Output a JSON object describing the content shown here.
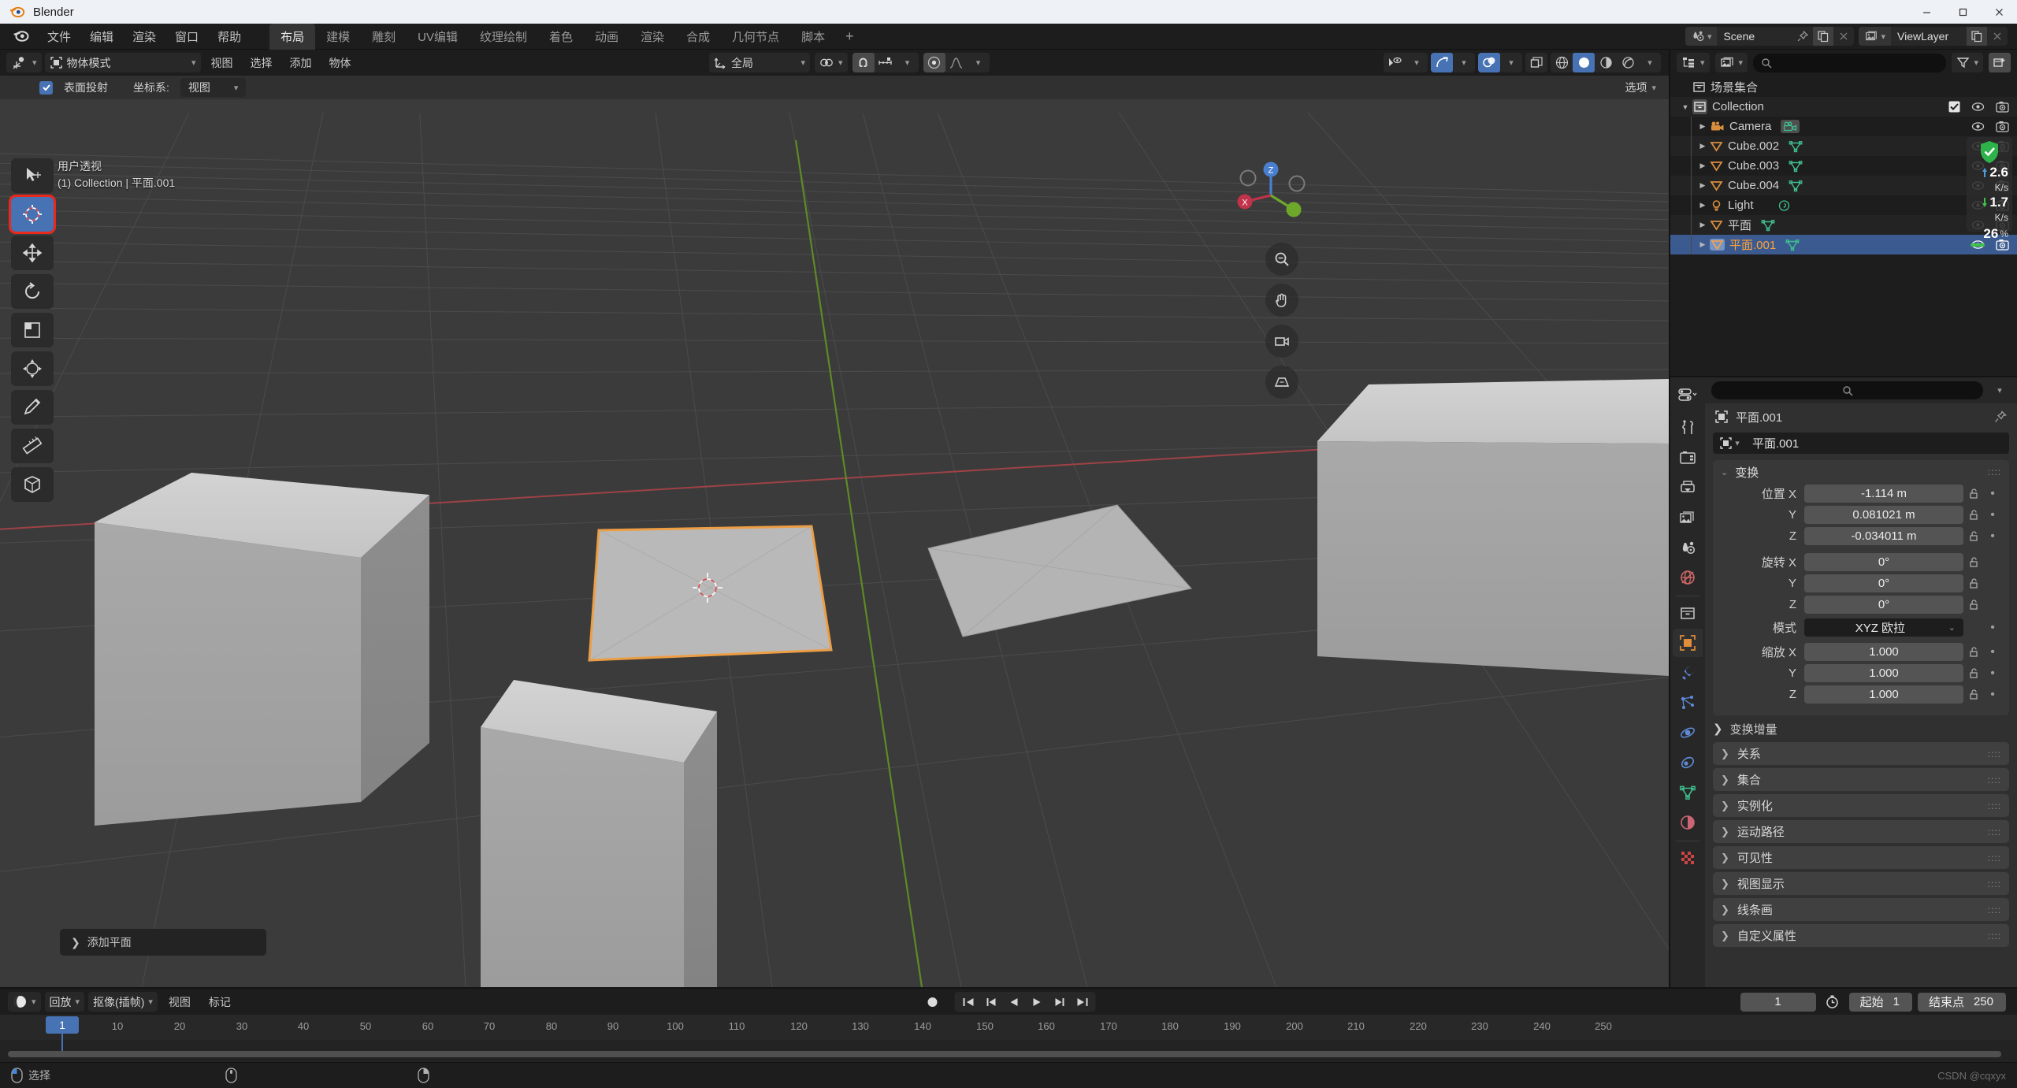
{
  "window": {
    "title": "Blender",
    "logo_icon": "blender-logo-icon",
    "minimize_icon": "minimize-icon",
    "maximize_icon": "maximize-icon",
    "close_icon": "close-icon"
  },
  "topbar": {
    "app_icon": "blender-icon",
    "menus": [
      {
        "label": "文件",
        "name": "menu-file"
      },
      {
        "label": "编辑",
        "name": "menu-edit"
      },
      {
        "label": "渲染",
        "name": "menu-render"
      },
      {
        "label": "窗口",
        "name": "menu-window"
      },
      {
        "label": "帮助",
        "name": "menu-help"
      }
    ],
    "workspaces": [
      {
        "label": "布局",
        "active": true
      },
      {
        "label": "建模",
        "active": false
      },
      {
        "label": "雕刻",
        "active": false
      },
      {
        "label": "UV编辑",
        "active": false
      },
      {
        "label": "纹理绘制",
        "active": false
      },
      {
        "label": "着色",
        "active": false
      },
      {
        "label": "动画",
        "active": false
      },
      {
        "label": "渲染",
        "active": false
      },
      {
        "label": "合成",
        "active": false
      },
      {
        "label": "几何节点",
        "active": false
      },
      {
        "label": "脚本",
        "active": false
      }
    ],
    "add_workspace_label": "+",
    "scene": {
      "name": "Scene",
      "icon": "scene-icon",
      "pin_icon": "pin-icon",
      "copy_icon": "new-scene-icon",
      "delete_icon": "unlink-icon"
    },
    "viewlayer": {
      "name": "ViewLayer",
      "icon": "viewlayer-icon",
      "copy_icon": "new-viewlayer-icon",
      "delete_icon": "remove-viewlayer-icon"
    }
  },
  "viewport": {
    "editor_type_icon": "editor-type-3dview-icon",
    "mode": "物体模式",
    "mode_icon": "object-mode-icon",
    "menus": [
      "视图",
      "选择",
      "添加",
      "物体"
    ],
    "transform_orientation": {
      "label": "全局",
      "icon": "orientation-icon"
    },
    "pivot_icon": "pivot-point-icon",
    "snap_icon": "snap-magnet-icon",
    "snap_target_icon": "snap-increment-icon",
    "proportional_icon": "proportional-edit-icon",
    "falloff_icon": "falloff-curve-icon",
    "right_controls": {
      "visibility_icon": "object-visibility-icon",
      "gizmo_icon": "gizmo-icon",
      "overlays_icon": "overlays-icon",
      "xray_icon": "xray-toggle-icon",
      "shading_modes": [
        "wireframe-shading-icon",
        "solid-shading-icon",
        "material-preview-icon",
        "rendered-shading-icon"
      ],
      "shading_active_index": 1
    },
    "subheader": {
      "checkbox_label": "表面投射",
      "checkbox_checked": true,
      "orientation_label": "坐标系:",
      "orientation_value": "视图",
      "options_label": "选项"
    },
    "overlay_text": {
      "line1": "用户透视",
      "line2": "(1) Collection | 平面.001"
    },
    "operator_panel": {
      "label": "添加平面",
      "expand_icon": "chevron-right-icon"
    },
    "toolbar": [
      {
        "name": "tool-tweak",
        "icon": "cursor-select-icon",
        "active": false,
        "highlight": false
      },
      {
        "name": "tool-cursor",
        "icon": "3d-cursor-icon",
        "active": true,
        "highlight": true
      },
      {
        "name": "tool-move",
        "icon": "move-icon",
        "active": false,
        "highlight": false
      },
      {
        "name": "tool-rotate",
        "icon": "rotate-icon",
        "active": false,
        "highlight": false
      },
      {
        "name": "tool-scale",
        "icon": "scale-icon",
        "active": false,
        "highlight": false
      },
      {
        "name": "tool-transform",
        "icon": "transform-icon",
        "active": false,
        "highlight": false
      },
      {
        "name": "tool-annotate",
        "icon": "annotate-pencil-icon",
        "active": false,
        "highlight": false
      },
      {
        "name": "tool-measure",
        "icon": "measure-ruler-icon",
        "active": false,
        "highlight": false
      },
      {
        "name": "tool-add-cube",
        "icon": "add-cube-icon",
        "active": false,
        "highlight": false
      }
    ],
    "nav_gizmo": {
      "axis_x_label": "X",
      "axis_y_label": "Y",
      "axis_z_label": "Z"
    },
    "nav_buttons": [
      {
        "name": "zoom-button",
        "icon": "zoom-icon"
      },
      {
        "name": "pan-button",
        "icon": "hand-pan-icon"
      },
      {
        "name": "camera-view-button",
        "icon": "camera-view-icon"
      },
      {
        "name": "toggle-projection-button",
        "icon": "perspective-ortho-icon"
      }
    ]
  },
  "outliner": {
    "display_mode_icon": "outliner-display-mode-icon",
    "filter_id_icon": "outliner-id-type-icon",
    "search_placeholder": "",
    "search_icon": "search-icon",
    "filter_icon": "filter-funnel-icon",
    "new_collection_icon": "new-collection-icon",
    "scene_collection": {
      "label": "场景集合",
      "icon": "collection-icon"
    },
    "rows": [
      {
        "label": "Collection",
        "icon": "collection-icon",
        "indent": 1,
        "expanded": true,
        "has_checkbox": true,
        "data_icon": "",
        "selected": false,
        "eye": true,
        "camera": true
      },
      {
        "label": "Camera",
        "icon": "camera-object-icon",
        "indent": 2,
        "expanded": false,
        "has_checkbox": false,
        "data_icon": "camera-data-icon",
        "selected": false,
        "eye": true,
        "camera": true
      },
      {
        "label": "Cube.002",
        "icon": "mesh-object-icon",
        "indent": 2,
        "expanded": false,
        "has_checkbox": false,
        "data_icon": "mesh-data-icon",
        "selected": false,
        "eye": true,
        "camera": true
      },
      {
        "label": "Cube.003",
        "icon": "mesh-object-icon",
        "indent": 2,
        "expanded": false,
        "has_checkbox": false,
        "data_icon": "mesh-data-icon",
        "selected": false,
        "eye": true,
        "camera": true
      },
      {
        "label": "Cube.004",
        "icon": "mesh-object-icon",
        "indent": 2,
        "expanded": false,
        "has_checkbox": false,
        "data_icon": "mesh-data-icon",
        "selected": false,
        "eye": true,
        "camera": true
      },
      {
        "label": "Light",
        "icon": "light-object-icon",
        "indent": 2,
        "expanded": false,
        "has_checkbox": false,
        "data_icon": "light-data-icon",
        "selected": false,
        "eye": true,
        "camera": true
      },
      {
        "label": "平面",
        "icon": "mesh-object-icon",
        "indent": 2,
        "expanded": false,
        "has_checkbox": false,
        "data_icon": "mesh-data-icon",
        "selected": false,
        "eye": true,
        "camera": true
      },
      {
        "label": "平面.001",
        "icon": "mesh-object-icon",
        "indent": 2,
        "expanded": false,
        "has_checkbox": false,
        "data_icon": "mesh-data-icon",
        "selected": true,
        "eye": true,
        "camera": true
      }
    ]
  },
  "properties": {
    "editor_icon": "properties-editor-icon",
    "search_icon": "search-icon",
    "menu_icon": "chevron-down-icon",
    "tabs": [
      {
        "name": "tool-tab",
        "icon": "tool-wrench-screwdriver-icon",
        "active": false,
        "color": "#c8c8c8"
      },
      {
        "name": "render-tab",
        "icon": "render-camera-back-icon",
        "active": false,
        "color": "#c8c8c8"
      },
      {
        "name": "output-tab",
        "icon": "output-printer-icon",
        "active": false,
        "color": "#c8c8c8"
      },
      {
        "name": "viewlayer-tab",
        "icon": "viewlayer-images-icon",
        "active": false,
        "color": "#c8c8c8"
      },
      {
        "name": "scene-tab",
        "icon": "scene-cone-icon",
        "active": false,
        "color": "#c8c8c8"
      },
      {
        "name": "world-tab",
        "icon": "world-globe-icon",
        "active": false,
        "color": "#cc6666"
      },
      {
        "name": "collection-tab",
        "icon": "collection-box-icon",
        "active": false,
        "color": "#c8c8c8"
      },
      {
        "name": "object-tab",
        "icon": "object-square-icon",
        "active": true,
        "color": "#e08c3a"
      },
      {
        "name": "modifier-tab",
        "icon": "modifier-wrench-icon",
        "active": false,
        "color": "#5e8ad6"
      },
      {
        "name": "particles-tab",
        "icon": "particles-icon",
        "active": false,
        "color": "#5e8ad6"
      },
      {
        "name": "physics-tab",
        "icon": "physics-orbit-icon",
        "active": false,
        "color": "#5e8ad6"
      },
      {
        "name": "constraints-tab",
        "icon": "constraints-icon",
        "active": false,
        "color": "#5e8ad6"
      },
      {
        "name": "data-tab",
        "icon": "mesh-data-triangle-icon",
        "active": false,
        "color": "#3fbf8f"
      },
      {
        "name": "material-tab",
        "icon": "material-sphere-icon",
        "active": false,
        "color": "#cc6677"
      },
      {
        "name": "texture-tab",
        "icon": "texture-checker-icon",
        "active": false,
        "color": "#cc4444"
      }
    ],
    "breadcrumb": {
      "icon": "object-square-icon",
      "label": "平面.001"
    },
    "name_field": {
      "icon": "object-square-icon",
      "value": "平面.001"
    },
    "pin_icon": "pin-icon",
    "transform_panel": {
      "title": "变换",
      "expanded": true,
      "location_label": "位置",
      "rotation_label": "旋转",
      "mode_label": "模式",
      "mode_value": "XYZ 欧拉",
      "scale_label": "缩放",
      "axes": [
        "X",
        "Y",
        "Z"
      ],
      "location": [
        "-1.114 m",
        "0.081021 m",
        "-0.034011 m"
      ],
      "rotation": [
        "0°",
        "0°",
        "0°"
      ],
      "scale": [
        "1.000",
        "1.000",
        "1.000"
      ],
      "delta_transform_label": "变换增量",
      "lock_icon": "unlock-padlock-icon"
    },
    "collapsed_panels": [
      "关系",
      "集合",
      "实例化",
      "运动路径",
      "可见性",
      "视图显示",
      "线条画",
      "自定义属性"
    ]
  },
  "network_overlay": {
    "upload_value": "2.6",
    "upload_unit": "K/s",
    "download_value": "1.7",
    "download_unit": "K/s",
    "percent": "26",
    "percent_unit": "%",
    "shield_icon": "security-shield-check-icon"
  },
  "timeline": {
    "editor_icon": "timeline-editor-icon",
    "menus": [
      {
        "label": "回放",
        "has_chevron": true
      },
      {
        "label": "抠像(插帧)",
        "has_chevron": true
      },
      {
        "label": "视图",
        "has_chevron": false
      },
      {
        "label": "标记",
        "has_chevron": false
      }
    ],
    "record_icon": "record-keyframe-icon",
    "playback_buttons": [
      "jump-to-start-icon",
      "previous-keyframe-icon",
      "play-reverse-icon",
      "play-icon",
      "next-keyframe-icon",
      "jump-to-end-icon"
    ],
    "current_frame": "1",
    "start_label": "起始",
    "start_value": "1",
    "end_label": "结束点",
    "end_value": "250",
    "timer_icon": "stopwatch-icon",
    "playhead_frame": "1",
    "ruler_ticks": [
      "10",
      "20",
      "30",
      "40",
      "50",
      "60",
      "70",
      "80",
      "90",
      "100",
      "110",
      "120",
      "130",
      "140",
      "150",
      "160",
      "170",
      "180",
      "190",
      "200",
      "210",
      "220",
      "230",
      "240",
      "250"
    ]
  },
  "statusbar": {
    "items": [
      {
        "icon": "mouse-left-click-icon",
        "label": "选择"
      },
      {
        "icon": "mouse-middle-click-icon",
        "label": ""
      },
      {
        "icon": "mouse-right-click-icon",
        "label": ""
      }
    ],
    "watermark": "CSDN @cqxyx"
  },
  "colors": {
    "accent_blue": "#4772b3",
    "selection_orange": "#ed9e45",
    "viewport_bg": "#3b3b3b",
    "panel_bg": "#303030",
    "header_bg": "#1d1d1d",
    "green_axis": "#6ca81f",
    "red_axis": "#a33b3b"
  }
}
